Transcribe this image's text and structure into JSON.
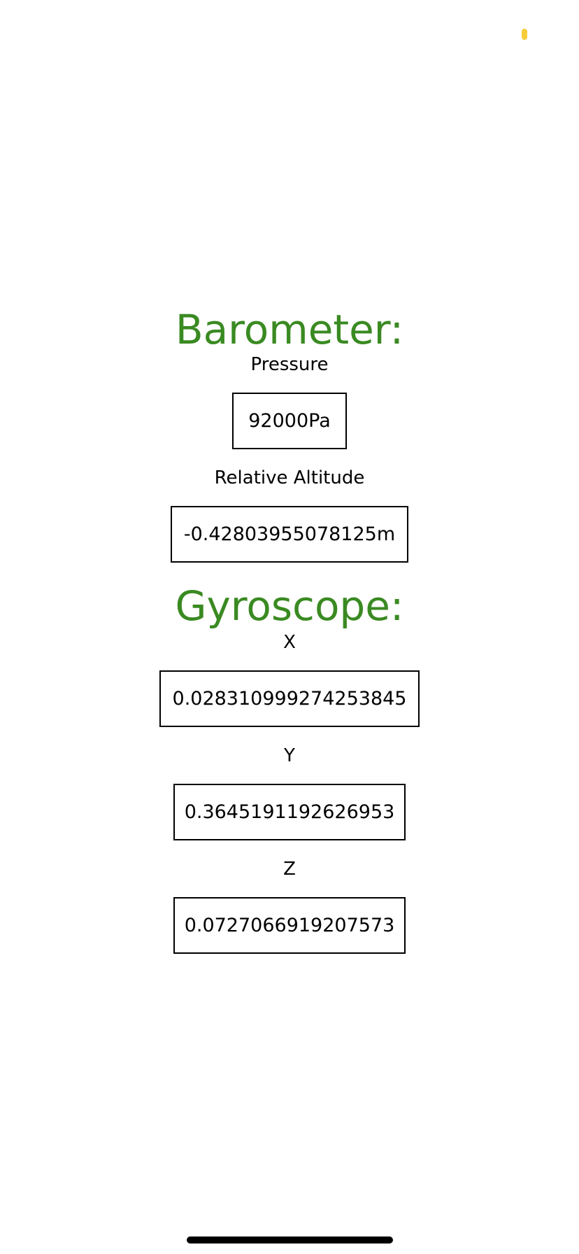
{
  "colors": {
    "heading": "#3a8a22",
    "status_indicator": "#f5cc3a",
    "text": "#000000",
    "background": "#ffffff"
  },
  "barometer": {
    "title": "Barometer:",
    "pressure_label": "Pressure",
    "pressure_value": "92000Pa",
    "altitude_label": "Relative Altitude",
    "altitude_value": "-0.42803955078125m"
  },
  "gyroscope": {
    "title": "Gyroscope:",
    "x_label": "X",
    "x_value": "0.028310999274253845",
    "y_label": "Y",
    "y_value": "0.3645191192626953",
    "z_label": "Z",
    "z_value": "0.0727066919207573"
  }
}
